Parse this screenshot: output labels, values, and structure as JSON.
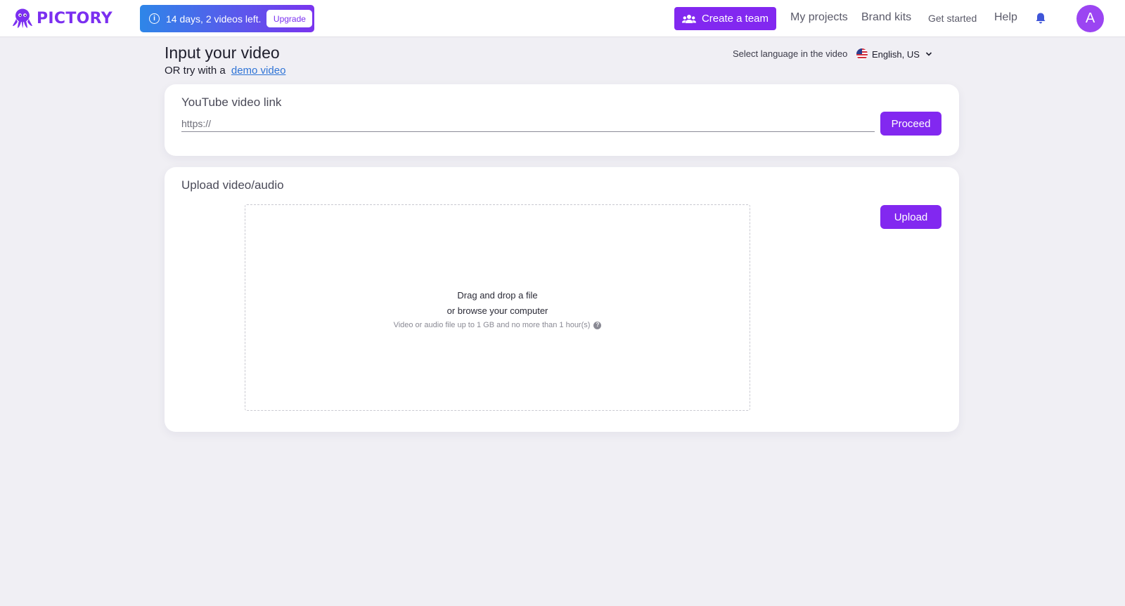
{
  "brand": {
    "name": "PICTORY",
    "accent": "#8228f0",
    "logo_icon": "octopus-logo-icon"
  },
  "trial": {
    "icon": "info-icon",
    "text": "14 days, 2 videos left.",
    "upgrade_label": "Upgrade"
  },
  "nav": {
    "create_team_label": "Create a team",
    "create_team_icon": "team-icon",
    "my_projects": "My projects",
    "brand_kits": "Brand kits",
    "get_started": "Get started",
    "help": "Help",
    "bell_icon": "bell-icon",
    "avatar_initial": "A"
  },
  "page": {
    "title": "Input your video",
    "demo_prefix": "OR try with a",
    "demo_link": "demo video"
  },
  "language": {
    "label": "Select language in the video",
    "flag_icon": "us-flag-icon",
    "selected": "English, US"
  },
  "youtube": {
    "title": "YouTube video link",
    "input_value": "",
    "placeholder": "https://",
    "proceed_label": "Proceed"
  },
  "upload": {
    "title": "Upload video/audio",
    "upload_label": "Upload",
    "drop_line1": "Drag and drop a file",
    "drop_line2": "or browse your computer",
    "hint": "Video or audio file up to 1 GB and no more than 1 hour(s)",
    "hint_icon": "question-icon"
  }
}
